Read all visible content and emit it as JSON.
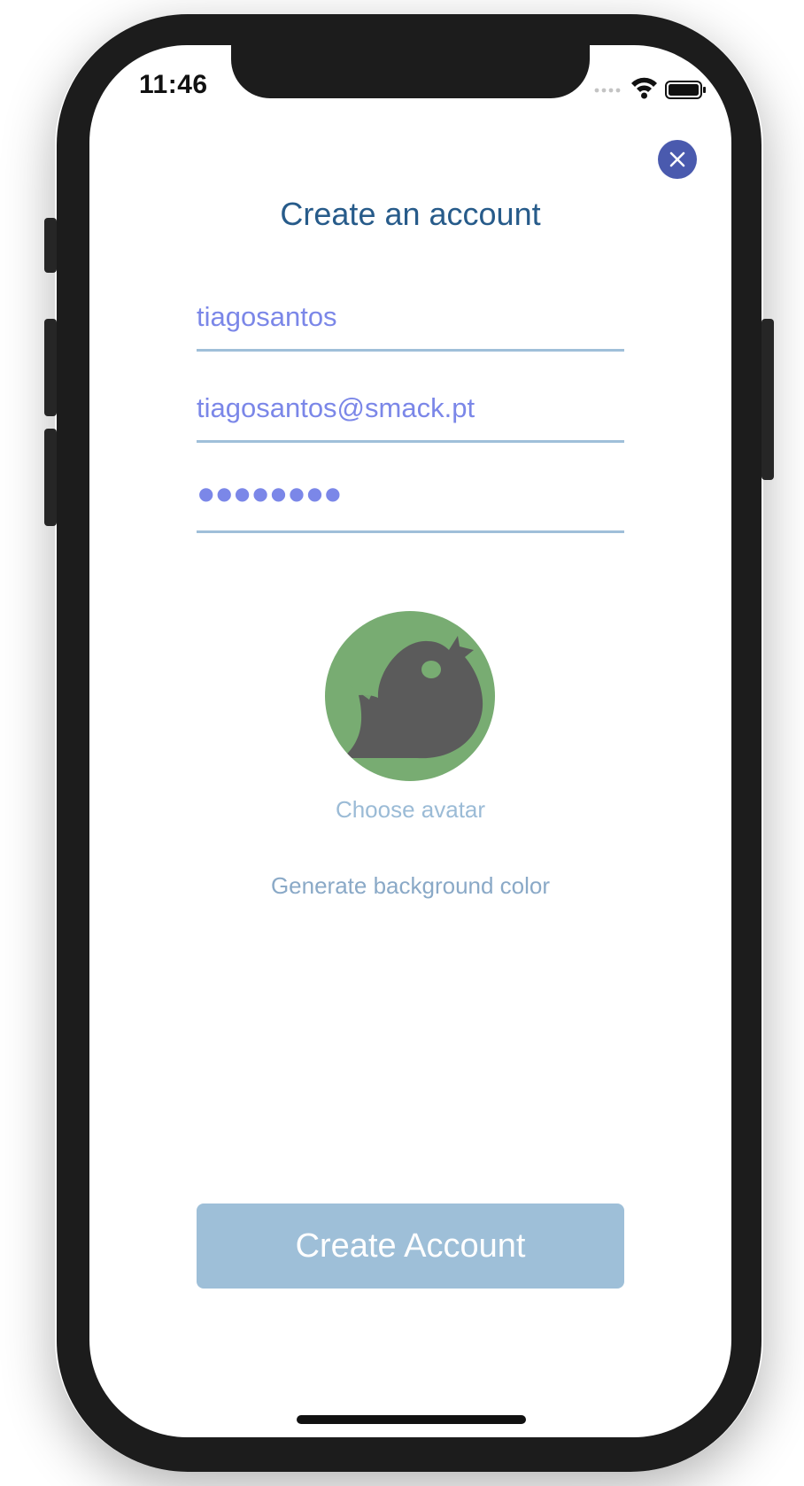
{
  "status_bar": {
    "time": "11:46",
    "icons": [
      "signal-dots-icon",
      "wifi-icon",
      "battery-icon"
    ]
  },
  "header": {
    "title": "Create an account",
    "close_icon": "close-icon"
  },
  "form": {
    "username_value": "tiagosantos",
    "email_value": "tiagosantos@smack.pt",
    "password_masked": "●●●●●●●●"
  },
  "avatar": {
    "icon": "bird-avatar-icon",
    "background_color": "#78ac72",
    "choose_label": "Choose avatar",
    "generate_label": "Generate background color"
  },
  "actions": {
    "create_label": "Create Account"
  },
  "colors": {
    "accent": "#4a5aae",
    "title": "#275b8a",
    "field_text": "#7b87e8",
    "button_bg": "#9ebfd8"
  }
}
